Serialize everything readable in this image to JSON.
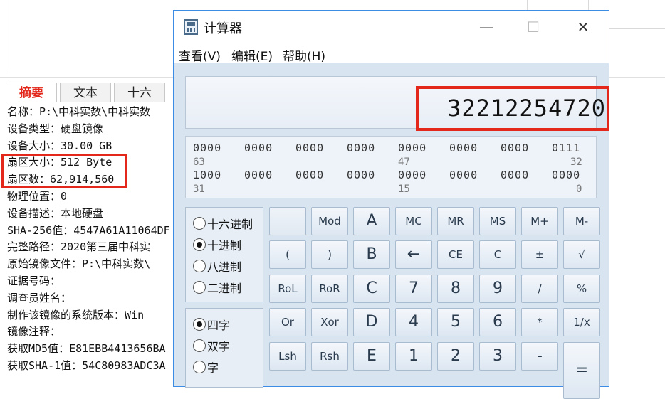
{
  "background": {
    "tabs": [
      {
        "label": "摘要",
        "active": true
      },
      {
        "label": "文本",
        "active": false
      },
      {
        "label": "十六",
        "active": false
      }
    ],
    "info_lines": [
      "名称：P:\\中科实数\\中科实数",
      "设备类型：硬盘镜像",
      "设备大小：30.00 GB",
      "扇区大小：512 Byte",
      "扇区数：62,914,560",
      "物理位置：0",
      "设备描述：本地硬盘",
      "SHA-256值：4547A61A11064DF",
      "完整路径：2020第三届中科实",
      "原始镜像文件：P:\\中科实数\\",
      "证据号码：",
      "调查员姓名：",
      "制作该镜像的系统版本：Win",
      "镜像注释：",
      "获取MD5值：E81EBB4413656BA",
      "获取SHA-1值：54C80983ADC3A"
    ]
  },
  "calculator": {
    "title": "计算器",
    "window_buttons": {
      "minimize": "—",
      "maximize": "☐",
      "close": "✕"
    },
    "menu": [
      "查看(V)",
      "编辑(E)",
      "帮助(H)"
    ],
    "display_value": "32212254720",
    "bit_rows": [
      {
        "groups": [
          "0000",
          "0000",
          "0000",
          "0000",
          "0000",
          "0000",
          "0000",
          "0111"
        ],
        "positions": [
          "63",
          "47",
          "32"
        ]
      },
      {
        "groups": [
          "1000",
          "0000",
          "0000",
          "0000",
          "0000",
          "0000",
          "0000",
          "0000"
        ],
        "positions": [
          "31",
          "15",
          "0"
        ]
      }
    ],
    "radix_options": [
      {
        "label": "十六进制",
        "checked": false
      },
      {
        "label": "十进制",
        "checked": true
      },
      {
        "label": "八进制",
        "checked": false
      },
      {
        "label": "二进制",
        "checked": false
      }
    ],
    "word_options": [
      {
        "label": "四字",
        "checked": true
      },
      {
        "label": "双字",
        "checked": false
      },
      {
        "label": "字",
        "checked": false
      }
    ],
    "keys": [
      [
        "",
        "Mod",
        "A",
        "MC",
        "MR",
        "MS",
        "M+",
        "M-"
      ],
      [
        "(",
        ")",
        "B",
        "←",
        "CE",
        "C",
        "±",
        "√"
      ],
      [
        "RoL",
        "RoR",
        "C",
        "7",
        "8",
        "9",
        "/",
        "%"
      ],
      [
        "Or",
        "Xor",
        "D",
        "4",
        "5",
        "6",
        "*",
        "1/x"
      ],
      [
        "Lsh",
        "Rsh",
        "E",
        "1",
        "2",
        "3",
        "-",
        "="
      ]
    ]
  }
}
